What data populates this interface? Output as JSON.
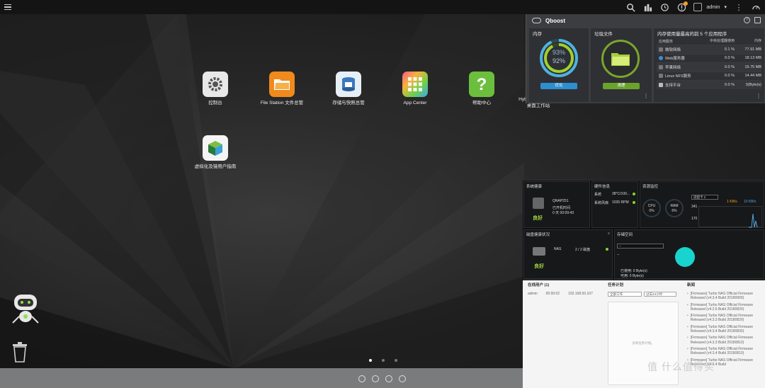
{
  "topbar": {
    "user": "admin"
  },
  "desktop_icons": [
    {
      "label": "控制台"
    },
    {
      "label": "File Station 文件总管"
    },
    {
      "label": "存储与快照总管"
    },
    {
      "label": "App Center"
    },
    {
      "label": "帮助中心"
    },
    {
      "label": "HybridDesk Station 桌面工作站"
    },
    {
      "label": "虚拟化及镜用户指南"
    }
  ],
  "qboost": {
    "title": "Qboost",
    "memory_label": "内存",
    "memory_pct_1": "93%",
    "memory_pct_2": "92%",
    "optimize_label": "优化",
    "junk_label": "垃圾文件",
    "clean_label": "清理",
    "top5_title": "内存使用量最高的前 5 个应用程序",
    "top5_headers": [
      "应用服务",
      "中央处理器使用",
      "内存"
    ],
    "top5_rows": [
      {
        "name": "微软网络",
        "cpu": "0.1 %",
        "mem": "77.91 MB"
      },
      {
        "name": "Web服务器",
        "cpu": "0.0 %",
        "mem": "18.13 MB"
      },
      {
        "name": "苹果网络",
        "cpu": "0.0 %",
        "mem": "15.75 MB"
      },
      {
        "name": "Linux NFS服务",
        "cpu": "0.0 %",
        "mem": "14.44 MB"
      },
      {
        "name": "支持平台",
        "cpu": "0.0 %",
        "mem": "0(Byte(s)"
      }
    ]
  },
  "dashboard": {
    "sys_health_title": "系统健康",
    "model": "QNAP251",
    "uptime_label": "已开机时间",
    "uptime": "0 天 00:09:43",
    "good": "良好",
    "hw_title": "硬件信息",
    "hw_system_label": "系统",
    "hw_system_value": "38°C/100...",
    "hw_fan_label": "系统风扇",
    "hw_fan_value": "1035 RPM",
    "res_title": "资源监控",
    "cpu_label": "CPU",
    "cpu_value": "0%",
    "ram_label": "RAM",
    "ram_value": "6%",
    "net_select": "适配卡 2",
    "net_in": "1 KB/s",
    "net_out": "10 KB/s",
    "axis_top": "341",
    "axis_mid": "170",
    "disk_title": "磁盘健康状况",
    "nas_label": "NAS",
    "disk_count": "2 / 2 磁盘",
    "storage_title": "存储空间",
    "storage_select": "--",
    "storage_dash": "--",
    "used": "已使用: 0 Byte(s)",
    "free": "可用: 0 Byte(s)"
  },
  "bottom": {
    "online_title": "在线用户 (1)",
    "online_user": "admin",
    "online_time": "00:00:02",
    "online_ip": "192.168.50.107",
    "task_title": "任务计划",
    "task_select_1": "全部工作",
    "task_select_2": "过去24小时",
    "task_empty": "没有任务计划。",
    "news_title": "新闻",
    "news": [
      "[Firmware] Turbo NAS Official Firmware Released (v4.3.4 Build 20180909)",
      "[Firmware] Turbo NAS Official Firmware Released (v4.2.6 Build 20180829)",
      "[Firmware] Turbo NAS Official Firmware Released (v4.3.3 Build 20180829)",
      "[Firmware] Turbo NAS Official Firmware Released (v4.3.4 Build 20180830)",
      "[Firmware] Turbo NAS Official Firmware Released (v4.3.3 Build 20180810)",
      "[Firmware] Turbo NAS Official Firmware Released (v4.3.4 Build 20180810)",
      "[Firmware] Turbo NAS Official Firmware Released (v4.3.4 Build"
    ]
  },
  "watermark": "值 什么值得买"
}
